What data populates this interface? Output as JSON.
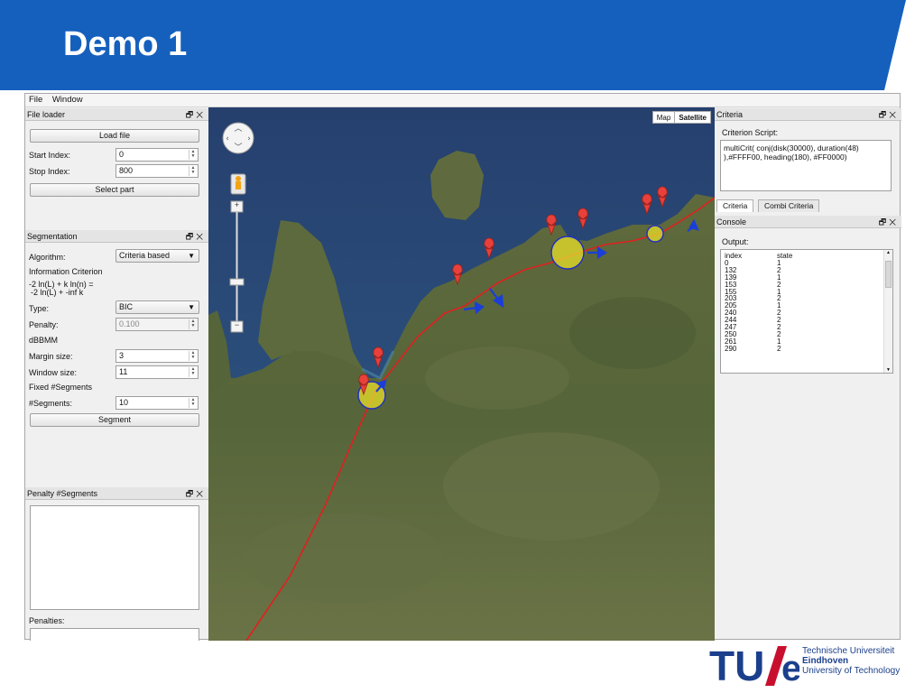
{
  "slide": {
    "title": "Demo 1"
  },
  "menubar": {
    "items": [
      "File",
      "Window"
    ]
  },
  "file_loader": {
    "title": "File loader",
    "load_button": "Load file",
    "start_label": "Start Index:",
    "start_value": "0",
    "stop_label": "Stop Index:",
    "stop_value": "800",
    "select_button": "Select part"
  },
  "segmentation": {
    "title": "Segmentation",
    "algorithm_label": "Algorithm:",
    "algorithm_value": "Criteria based",
    "info_criterion": "Information Criterion",
    "formula_1": "-2 ln(L) + k ln(n) =",
    "formula_2": "-2 ln(L) + -inf k",
    "type_label": "Type:",
    "type_value": "BIC",
    "penalty_label": "Penalty:",
    "penalty_value": "0.100",
    "dbbmm": "dBBMM",
    "margin_label": "Margin size:",
    "margin_value": "3",
    "window_label": "Window size:",
    "window_value": "11",
    "fixed_label": "Fixed #Segments",
    "segments_label": "#Segments:",
    "segments_value": "10",
    "segment_button": "Segment"
  },
  "penalty_panel": {
    "title": "Penalty #Segments",
    "penalties_label": "Penalties:"
  },
  "map": {
    "type_map": "Map",
    "type_satellite": "Satellite",
    "selected_type": "Satellite",
    "zoom_in": "+",
    "zoom_out": "−"
  },
  "criteria": {
    "title": "Criteria",
    "script_label": "Criterion Script:",
    "script_line1": "multiCrit( conj(disk(30000), duration(48)",
    "script_line2": "),#FFFF00, heading(180), #FF0000)",
    "tabs": [
      "Criteria",
      "Combi Criteria"
    ]
  },
  "console": {
    "title": "Console",
    "output_label": "Output:",
    "headers": [
      "index",
      "state"
    ],
    "rows": [
      [
        "0",
        "1"
      ],
      [
        "132",
        "2"
      ],
      [
        "139",
        "1"
      ],
      [
        "153",
        "2"
      ],
      [
        "155",
        "1"
      ],
      [
        "203",
        "2"
      ],
      [
        "205",
        "1"
      ],
      [
        "240",
        "2"
      ],
      [
        "244",
        "2"
      ],
      [
        "247",
        "2"
      ],
      [
        "250",
        "2"
      ],
      [
        "261",
        "1"
      ],
      [
        "290",
        "2"
      ]
    ]
  },
  "logo": {
    "mark": "TU/e",
    "line1": "Technische Universiteit",
    "line2": "Eindhoven",
    "line3": "University of Technology"
  },
  "colors": {
    "banner": "#1560bd",
    "track": "#e02020",
    "highlight": "#e8e02a",
    "marker": "#e8403a",
    "heading_arrow": "#1a3fd6",
    "logo_blue": "#1b3f8c",
    "logo_red": "#c8102e"
  }
}
